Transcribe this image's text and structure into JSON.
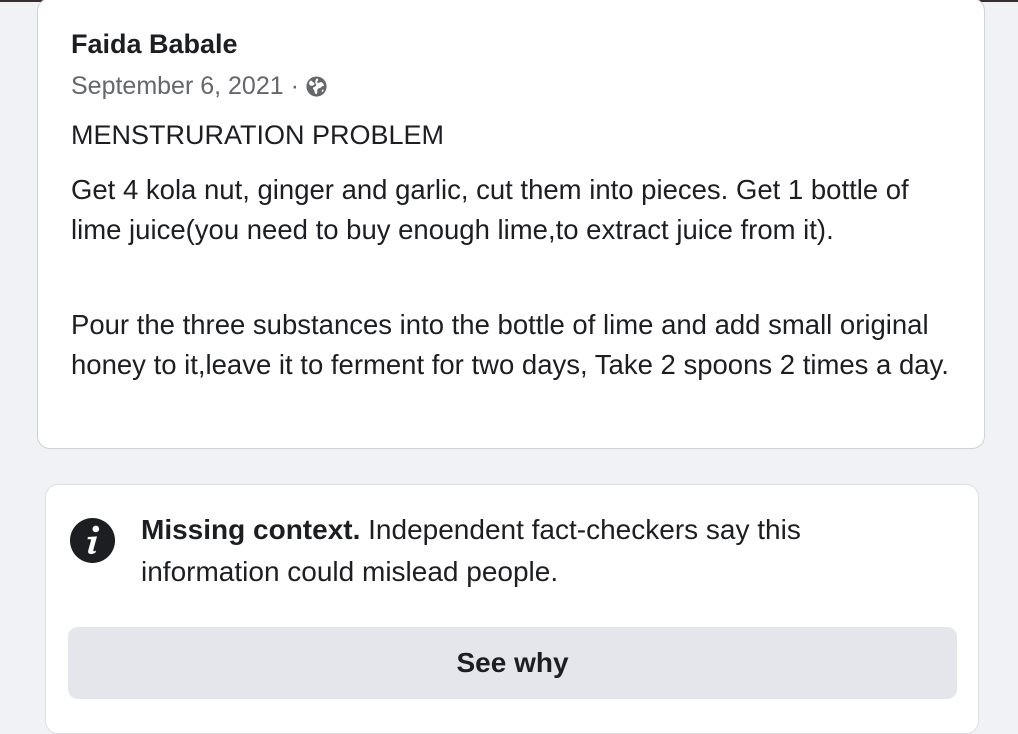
{
  "post": {
    "author": "Faida Babale",
    "date": "September 6, 2021",
    "separator": "·",
    "audience_icon": "globe-icon",
    "title": "MENSTRURATION PROBLEM",
    "paragraphs": [
      "Get 4 kola nut, ginger and garlic, cut them into pieces. Get 1 bottle of lime juice(you need to buy enough lime,to extract juice from it).",
      "Pour the three substances into the bottle of lime and add small original honey to it,leave it to ferment  for two days, Take 2 spoons 2 times a day."
    ]
  },
  "fact_check": {
    "icon": "info-icon",
    "heading": "Missing context.",
    "message": "Independent fact-checkers say this information could mislead people.",
    "button_label": "See why"
  },
  "colors": {
    "background": "#f0f2f5",
    "card": "#ffffff",
    "secondary_text": "#65676b",
    "button_bg": "#e4e6eb"
  }
}
